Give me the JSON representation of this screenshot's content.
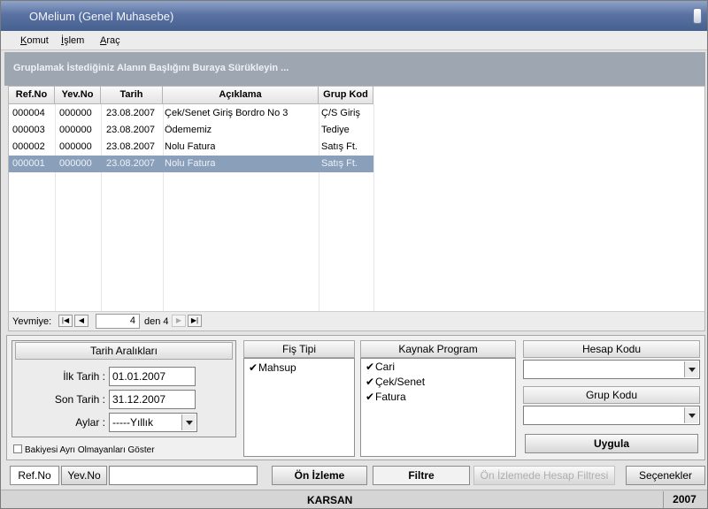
{
  "window": {
    "title": "OMelium (Genel Muhasebe)"
  },
  "menu": [
    "Komut",
    "İşlem",
    "Araç"
  ],
  "group_hint": "Gruplamak İstediğiniz Alanın Başlığını Buraya Sürükleyin ...",
  "grid": {
    "columns": [
      "Ref.No",
      "Yev.No",
      "Tarih",
      "Açıklama",
      "Grup Kod"
    ],
    "rows": [
      [
        "000004",
        "000000",
        "23.08.2007",
        "Çek/Senet Giriş Bordro No 3",
        "Ç/S Giriş"
      ],
      [
        "000003",
        "000000",
        "23.08.2007",
        "Ödememiz",
        "Tediye"
      ],
      [
        "000002",
        "000000",
        "23.08.2007",
        "Nolu Fatura",
        "Satış Ft."
      ],
      [
        "000001",
        "000000",
        "23.08.2007",
        "Nolu Fatura",
        "Satış Ft."
      ]
    ],
    "selected_row": 3
  },
  "navigator": {
    "label": "Yevmiye:",
    "current": "4",
    "of_text": "den 4"
  },
  "date_panel": {
    "title": "Tarih Aralıkları",
    "start_label": "İlk Tarih :",
    "start_value": "01.01.2007",
    "end_label": "Son Tarih :",
    "end_value": "31.12.2007",
    "months_label": "Aylar :",
    "months_value": "-----Yıllık",
    "balance_check": "Bakiyesi Ayrı Olmayanları Göster"
  },
  "fis_tipi": {
    "title": "Fiş Tipi",
    "items": [
      "Mahsup"
    ]
  },
  "kaynak": {
    "title": "Kaynak Program",
    "items": [
      "Cari",
      "Çek/Senet",
      "Fatura"
    ]
  },
  "hesap_kodu": {
    "title": "Hesap Kodu"
  },
  "grup_kodu": {
    "title": "Grup Kodu"
  },
  "buttons": {
    "apply": "Uygula",
    "preview": "Ön İzleme",
    "filter": "Filtre",
    "preview_filter": "Ön İzlemede Hesap Filtresi",
    "options": "Seçenekler"
  },
  "tabs": [
    "Ref.No",
    "Yev.No"
  ],
  "status": {
    "company": "KARSAN",
    "year": "2007"
  }
}
